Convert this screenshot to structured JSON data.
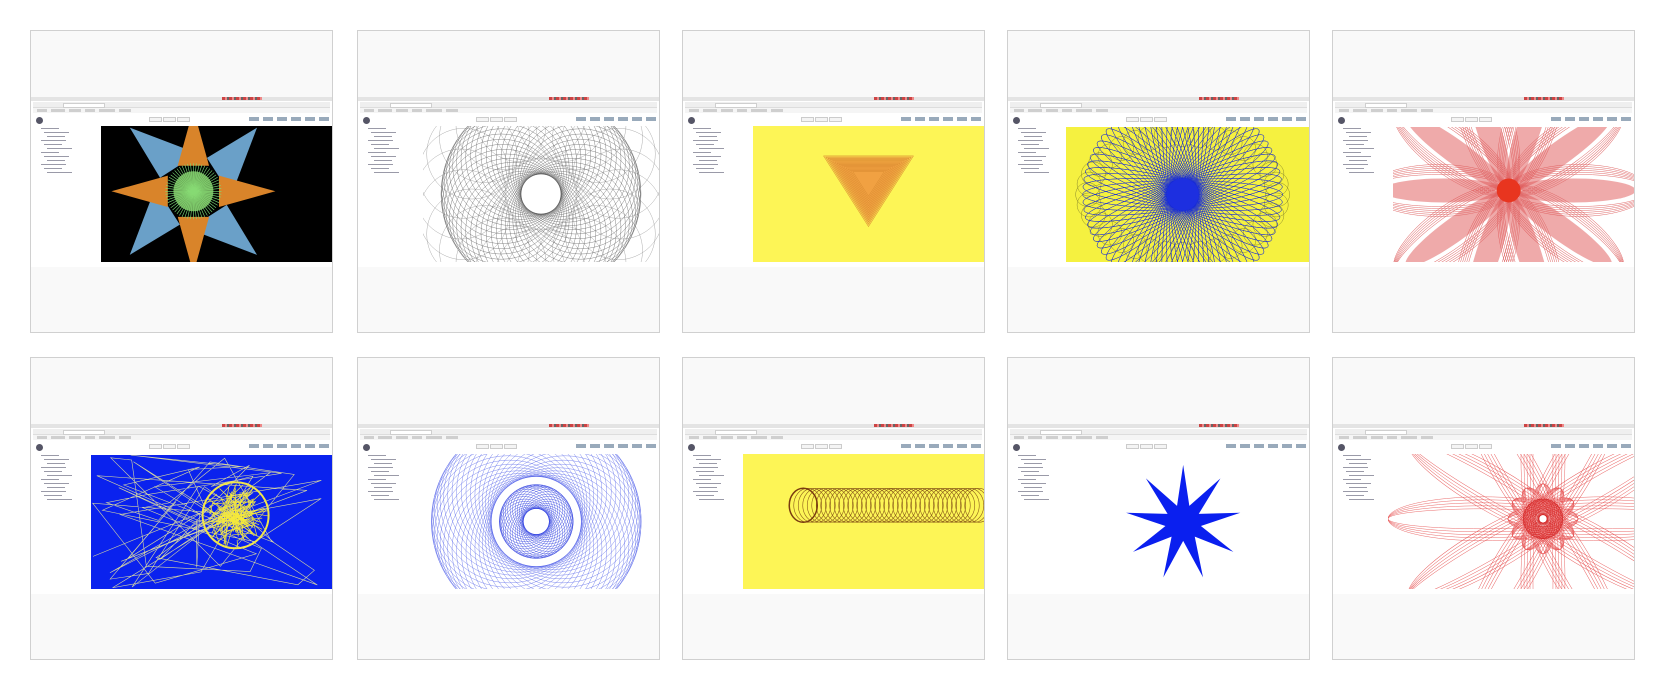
{
  "gallery": {
    "tiles": [
      {
        "name": "gallery-tile-star-spiral",
        "bg": "#000000",
        "pattern": "star-spiral"
      },
      {
        "name": "gallery-tile-gray-circles",
        "bg": "#ffffff",
        "pattern": "gray-circles"
      },
      {
        "name": "gallery-tile-orange-triangle",
        "bg": "#fdf556",
        "pattern": "orange-triangle"
      },
      {
        "name": "gallery-tile-blue-flower-yellow",
        "bg": "#f5f140",
        "pattern": "blue-flower"
      },
      {
        "name": "gallery-tile-red-flower",
        "bg": "#ffffff",
        "pattern": "red-flower"
      },
      {
        "name": "gallery-tile-yellow-scribble",
        "bg": "#0a22ee",
        "pattern": "yellow-scribble"
      },
      {
        "name": "gallery-tile-blue-circles",
        "bg": "#ffffff",
        "pattern": "blue-circles"
      },
      {
        "name": "gallery-tile-brown-tube",
        "bg": "#fdf556",
        "pattern": "brown-tube"
      },
      {
        "name": "gallery-tile-blue-star",
        "bg": "#ffffff",
        "pattern": "blue-star"
      },
      {
        "name": "gallery-tile-red-spirograph",
        "bg": "#ffffff",
        "pattern": "red-spirograph"
      }
    ]
  }
}
